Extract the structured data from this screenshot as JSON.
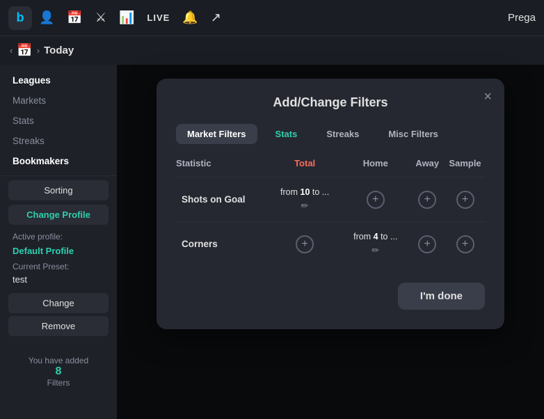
{
  "topNav": {
    "logo": "b",
    "liveLabel": "LIVE",
    "userLabel": "Prega"
  },
  "breadcrumb": {
    "todayLabel": "Today"
  },
  "sidebar": {
    "navItems": [
      {
        "label": "Leagues",
        "state": "active"
      },
      {
        "label": "Markets",
        "state": "muted"
      },
      {
        "label": "Stats",
        "state": "muted"
      },
      {
        "label": "Streaks",
        "state": "muted"
      },
      {
        "label": "Bookmakers",
        "state": "active"
      }
    ],
    "sortingLabel": "Sorting",
    "changeProfileLabel": "Change Profile",
    "activeProfileLabel": "Active profile:",
    "activeProfileValue": "Default Profile",
    "currentPresetLabel": "Current Preset:",
    "currentPresetValue": "test",
    "changeBtn": "Change",
    "removeBtn": "Remove",
    "addedLabel": "You have added",
    "addedCount": "8",
    "filtersLabel": "Filters"
  },
  "modal": {
    "title": "Add/Change Filters",
    "closeLabel": "×",
    "tabs": [
      {
        "label": "Market Filters",
        "state": "active-white"
      },
      {
        "label": "Stats",
        "state": "active-teal"
      },
      {
        "label": "Streaks",
        "state": "normal"
      },
      {
        "label": "Misc Filters",
        "state": "normal"
      }
    ],
    "tableHeaders": [
      "Statistic",
      "Total",
      "Home",
      "Away",
      "Sample"
    ],
    "rows": [
      {
        "statistic": "Shots on Goal",
        "total": {
          "type": "value",
          "text": "from ",
          "highlight": "10",
          "suffix": " to ..."
        },
        "home": {
          "type": "add"
        },
        "away": {
          "type": "add"
        },
        "sample": {
          "type": "add"
        }
      },
      {
        "statistic": "Corners",
        "total": {
          "type": "add"
        },
        "home": {
          "type": "value",
          "text": "from ",
          "highlight": "4",
          "suffix": " to ..."
        },
        "away": {
          "type": "add"
        },
        "sample": {
          "type": "add"
        }
      }
    ],
    "doneLabel": "I'm done"
  }
}
